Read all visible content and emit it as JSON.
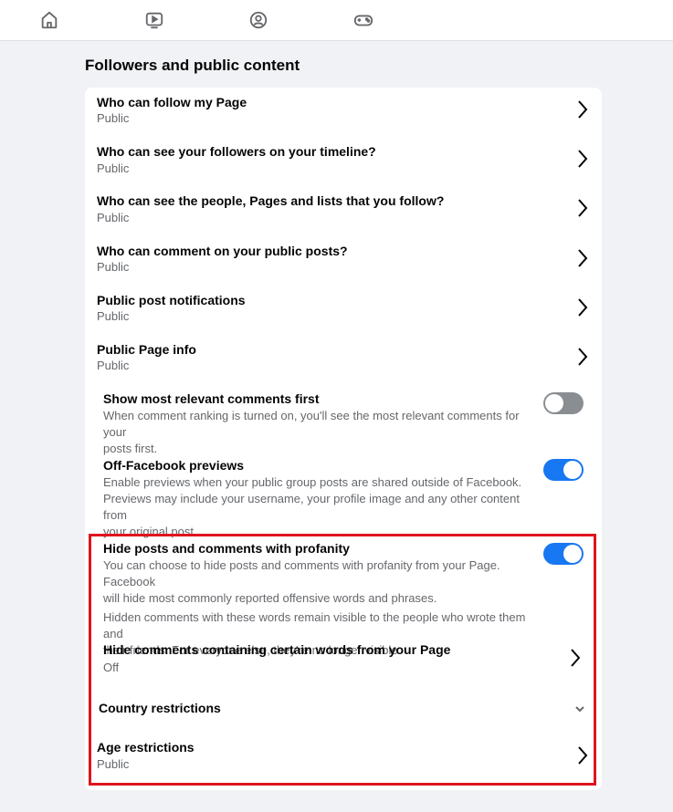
{
  "nav": {
    "items": [
      {
        "icon": "home-icon"
      },
      {
        "icon": "video-icon"
      },
      {
        "icon": "groups-icon"
      },
      {
        "icon": "gaming-icon"
      }
    ]
  },
  "section": {
    "title": "Followers and public content"
  },
  "rows": [
    {
      "title": "Who can follow my Page",
      "value": "Public"
    },
    {
      "title": "Who can see your followers on your timeline?",
      "value": "Public"
    },
    {
      "title": "Who can see the people, Pages and lists that you follow?",
      "value": "Public"
    },
    {
      "title": "Who can comment on your public posts?",
      "value": "Public"
    },
    {
      "title": "Public post notifications",
      "value": "Public"
    },
    {
      "title": "Public Page info",
      "value": "Public"
    }
  ],
  "toggles": {
    "relevant_comments": {
      "title": "Show most relevant comments first",
      "desc1": "When comment ranking is turned on, you'll see the most relevant comments for your",
      "desc2": "posts first.",
      "state": "off"
    },
    "off_facebook": {
      "title": "Off-Facebook previews",
      "desc1": "Enable previews when your public group posts are shared outside of Facebook.",
      "desc2": "Previews may include your username, your profile image and any other content from",
      "desc3": "your original post.",
      "state": "on"
    },
    "profanity": {
      "title": "Hide posts and comments with profanity",
      "desc1": "You can choose to hide posts and comments with profanity from your Page. Facebook",
      "desc2": "will hide most commonly reported offensive words and phrases.",
      "desc3": "Hidden comments with these words remain visible to the people who wrote them and",
      "desc4": "their friends. For everyone else, they're no longer visible.",
      "state": "on"
    }
  },
  "hide_words": {
    "title": "Hide comments containing certain words from your Page",
    "value": "Off"
  },
  "country": {
    "title": "Country restrictions"
  },
  "age": {
    "title": "Age restrictions",
    "value": "Public"
  },
  "colors": {
    "accent": "#1877f2",
    "highlight": "#e0141e",
    "toggle_off": "#8a8d91"
  }
}
